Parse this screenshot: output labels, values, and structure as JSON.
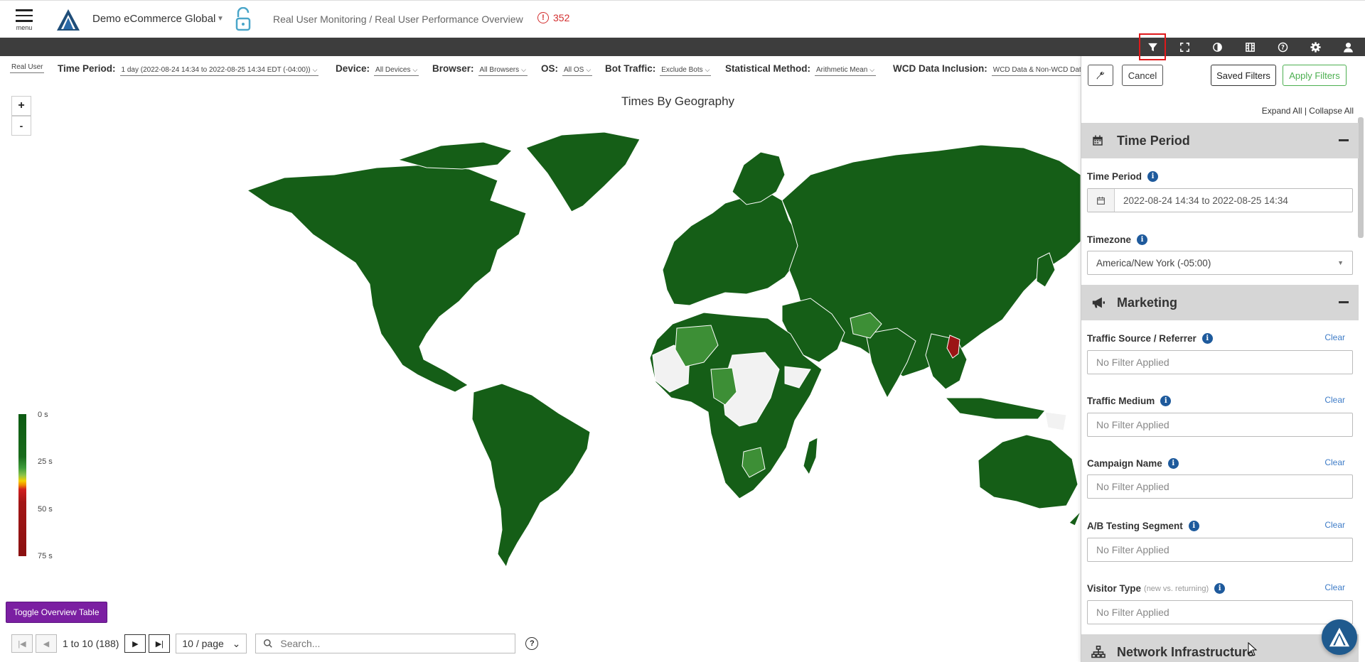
{
  "header": {
    "menu_label": "menu",
    "org_name": "Demo eCommerce Global",
    "breadcrumb": "Real User Monitoring / Real User Performance Overview",
    "alert_count": "352"
  },
  "toolbar": {
    "icons": [
      "filter-icon",
      "fullscreen-icon",
      "contrast-icon",
      "columns-icon",
      "help-icon",
      "settings-icon",
      "user-icon"
    ]
  },
  "filters": {
    "data_source": "Real User",
    "time_period": {
      "label": "Time Period:",
      "value": "1 day (2022-08-24 14:34 to 2022-08-25 14:34 EDT (-04:00))"
    },
    "device": {
      "label": "Device:",
      "value": "All Devices"
    },
    "browser": {
      "label": "Browser:",
      "value": "All Browsers"
    },
    "os": {
      "label": "OS:",
      "value": "All OS"
    },
    "bot": {
      "label": "Bot Traffic:",
      "value": "Exclude Bots"
    },
    "stat": {
      "label": "Statistical Method:",
      "value": "Arithmetic Mean"
    },
    "wcd": {
      "label": "WCD Data Inclusion:",
      "value": "WCD Data & Non-WCD Data"
    }
  },
  "map": {
    "title": "Times By Geography",
    "zoom_in": "+",
    "zoom_out": "-",
    "legend": [
      "0 s",
      "25 s",
      "50 s",
      "75 s"
    ],
    "colors": {
      "dark_green": "#155e17",
      "mid_green": "#3d8f36",
      "light": "#f2f2f2",
      "red": "#9b1515"
    }
  },
  "toggle_button": "Toggle Overview Table",
  "pagination": {
    "range": "1 to 10 (188)",
    "per_page": "10 / page",
    "search_placeholder": "Search...",
    "help": "?"
  },
  "panel": {
    "cancel": "Cancel",
    "saved_filters": "Saved Filters",
    "apply_filters": "Apply Filters",
    "expand_all": "Expand All",
    "separator": " | ",
    "collapse_all": "Collapse All",
    "sections": {
      "time_period": "Time Period",
      "marketing": "Marketing",
      "network": "Network Infrastructure"
    },
    "time_period_label": "Time Period",
    "time_period_value": "2022-08-24 14:34 to 2022-08-25 14:34",
    "timezone_label": "Timezone",
    "timezone_value": "America/New York (-05:00)",
    "clear": "Clear",
    "no_filter": "No Filter Applied",
    "fields": [
      {
        "label": "Traffic Source / Referrer",
        "sub": ""
      },
      {
        "label": "Traffic Medium",
        "sub": ""
      },
      {
        "label": "Campaign Name",
        "sub": ""
      },
      {
        "label": "A/B Testing Segment",
        "sub": ""
      },
      {
        "label": "Visitor Type",
        "sub": "(new vs. returning)"
      }
    ]
  }
}
